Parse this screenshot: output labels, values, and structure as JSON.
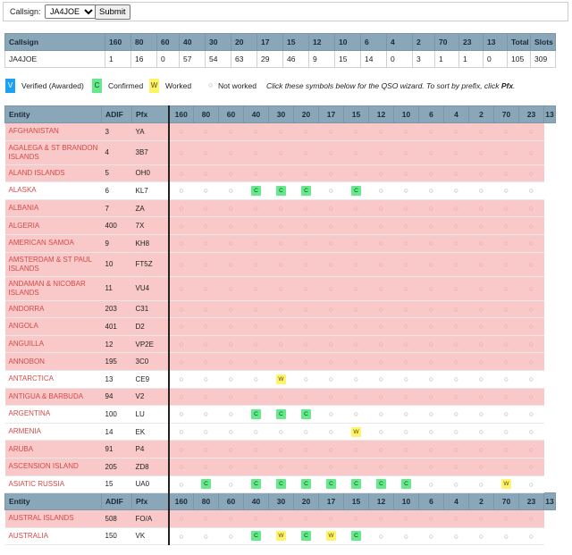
{
  "form": {
    "label": "Callsign:",
    "callsign": "JA4JOE",
    "submit_label": "Submit"
  },
  "summary": {
    "headers": [
      "Callsign",
      "160",
      "80",
      "60",
      "40",
      "30",
      "20",
      "17",
      "15",
      "12",
      "10",
      "6",
      "4",
      "2",
      "70",
      "23",
      "13",
      "Total",
      "Slots"
    ],
    "values": [
      "JA4JOE",
      "1",
      "16",
      "0",
      "57",
      "54",
      "63",
      "29",
      "46",
      "9",
      "15",
      "14",
      "0",
      "3",
      "1",
      "1",
      "0",
      "105",
      "309"
    ]
  },
  "legend": {
    "verified_symbol": "V",
    "verified_label": "Verified (Awarded)",
    "confirmed_symbol": "C",
    "confirmed_label": "Confirmed",
    "worked_symbol": "W",
    "worked_label": "Worked",
    "not_worked_symbol": "○",
    "not_worked_label": "Not worked",
    "hint_prefix": "Click these symbols below for the QSO wizard. To sort by prefix, click ",
    "hint_link": "Pfx",
    "hint_suffix": ".",
    "colors": {
      "verified": "#1da1f2",
      "confirmed": "#65e98a",
      "worked": "#fff36b"
    }
  },
  "table": {
    "headers": [
      "Entity",
      "ADIF",
      "Pfx",
      "160",
      "80",
      "60",
      "40",
      "30",
      "20",
      "17",
      "15",
      "12",
      "10",
      "6",
      "4",
      "2",
      "70",
      "23",
      "13"
    ],
    "rows": [
      {
        "entity": "AFGHANISTAN",
        "adif": "3",
        "pfx": "YA",
        "s": "..............."
      },
      {
        "entity": "AGALEGA & ST BRANDON ISLANDS",
        "adif": "4",
        "pfx": "3B7",
        "s": "...............",
        "tall": true
      },
      {
        "entity": "ALAND ISLANDS",
        "adif": "5",
        "pfx": "OH0",
        "s": "..............."
      },
      {
        "entity": "ALASKA",
        "adif": "6",
        "pfx": "KL7",
        "s": "...CCC.C.......",
        "worked": true
      },
      {
        "entity": "ALBANIA",
        "adif": "7",
        "pfx": "ZA",
        "s": "..............."
      },
      {
        "entity": "ALGERIA",
        "adif": "400",
        "pfx": "7X",
        "s": "..............."
      },
      {
        "entity": "AMERICAN SAMOA",
        "adif": "9",
        "pfx": "KH8",
        "s": "..............."
      },
      {
        "entity": "AMSTERDAM & ST PAUL ISLANDS",
        "adif": "10",
        "pfx": "FT5Z",
        "s": "...............",
        "tall": true
      },
      {
        "entity": "ANDAMAN & NICOBAR ISLANDS",
        "adif": "11",
        "pfx": "VU4",
        "s": "...............",
        "tall": true
      },
      {
        "entity": "ANDORRA",
        "adif": "203",
        "pfx": "C31",
        "s": "..............."
      },
      {
        "entity": "ANGOLA",
        "adif": "401",
        "pfx": "D2",
        "s": "..............."
      },
      {
        "entity": "ANGUILLA",
        "adif": "12",
        "pfx": "VP2E",
        "s": "..............."
      },
      {
        "entity": "ANNOBON",
        "adif": "195",
        "pfx": "3C0",
        "s": "..............."
      },
      {
        "entity": "ANTARCTICA",
        "adif": "13",
        "pfx": "CE9",
        "s": "....W..........",
        "worked": true
      },
      {
        "entity": "ANTIGUA & BARBUDA",
        "adif": "94",
        "pfx": "V2",
        "s": "..............."
      },
      {
        "entity": "ARGENTINA",
        "adif": "100",
        "pfx": "LU",
        "s": "...CCC.........",
        "worked": true
      },
      {
        "entity": "ARMENIA",
        "adif": "14",
        "pfx": "EK",
        "s": ".......W.......",
        "worked": true
      },
      {
        "entity": "ARUBA",
        "adif": "91",
        "pfx": "P4",
        "s": "..............."
      },
      {
        "entity": "ASCENSION ISLAND",
        "adif": "205",
        "pfx": "ZD8",
        "s": "..............."
      },
      {
        "entity": "ASIATIC RUSSIA",
        "adif": "15",
        "pfx": "UA0",
        "s": ".C.CCCCCCC...W.",
        "worked": true
      },
      {
        "header": true
      },
      {
        "entity": "AUSTRAL ISLANDS",
        "adif": "508",
        "pfx": "FO/A",
        "s": "..............."
      },
      {
        "entity": "AUSTRALIA",
        "adif": "150",
        "pfx": "VK",
        "s": "...CWCWC.......",
        "worked": true
      }
    ]
  }
}
